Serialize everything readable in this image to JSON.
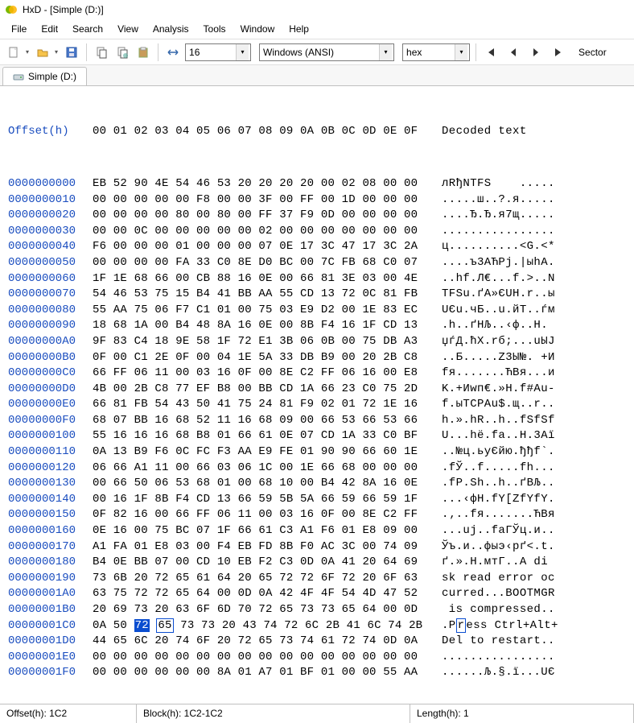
{
  "window_title": "HxD - [Simple (D:)]",
  "menu": {
    "items": [
      "File",
      "Edit",
      "Search",
      "View",
      "Analysis",
      "Tools",
      "Window",
      "Help"
    ]
  },
  "toolbar": {
    "bytes_per_row": "16",
    "encoding": "Windows (ANSI)",
    "numbase": "hex",
    "nav_label": "Sector"
  },
  "tab": {
    "label": "Simple (D:)"
  },
  "hex": {
    "header_offset": "Offset(h)",
    "header_cols": "00 01 02 03 04 05 06 07 08 09 0A 0B 0C 0D 0E 0F",
    "header_decoded": "Decoded text",
    "rows": [
      {
        "o": "0000000000",
        "b": "EB 52 90 4E 54 46 53 20 20 20 20 00 02 08 00 00",
        "d": "лRђNTFS    ....."
      },
      {
        "o": "0000000010",
        "b": "00 00 00 00 00 F8 00 00 3F 00 FF 00 1D 00 00 00",
        "d": ".....ш..?.я....."
      },
      {
        "o": "0000000020",
        "b": "00 00 00 00 80 00 80 00 FF 37 F9 0D 00 00 00 00",
        "d": "....Ђ.Ђ.я7щ....."
      },
      {
        "o": "0000000030",
        "b": "00 00 0C 00 00 00 00 00 02 00 00 00 00 00 00 00",
        "d": "................"
      },
      {
        "o": "0000000040",
        "b": "F6 00 00 00 01 00 00 00 07 0E 17 3C 47 17 3C 2A",
        "d": "ц..........<G.<*"
      },
      {
        "o": "0000000050",
        "b": "00 00 00 00 FA 33 C0 8E D0 BC 00 7C FB 68 C0 07",
        "d": "....ъ3АЋРј.|ыhА."
      },
      {
        "o": "0000000060",
        "b": "1F 1E 68 66 00 CB 88 16 0E 00 66 81 3E 03 00 4E",
        "d": "..hf.Л€...f.>..N"
      },
      {
        "o": "0000000070",
        "b": "54 46 53 75 15 B4 41 BB AA 55 CD 13 72 0C 81 FB",
        "d": "TFSu.ґA»ЄUН.r..ы"
      },
      {
        "o": "0000000080",
        "b": "55 AA 75 06 F7 C1 01 00 75 03 E9 D2 00 1E 83 EC",
        "d": "UЄu.чБ..u.йТ..ѓм"
      },
      {
        "o": "0000000090",
        "b": "18 68 1A 00 B4 48 8A 16 0E 00 8B F4 16 1F CD 13",
        "d": ".h..ґHЉ..‹ф..Н."
      },
      {
        "o": "00000000A0",
        "b": "9F 83 C4 18 9E 58 1F 72 E1 3B 06 0B 00 75 DB A3",
        "d": "џѓД.ћX.rб;...uЫЈ"
      },
      {
        "o": "00000000B0",
        "b": "0F 00 C1 2E 0F 00 04 1E 5A 33 DB B9 00 20 2B C8",
        "d": "..Б.....Z3Ы№. +И"
      },
      {
        "o": "00000000C0",
        "b": "66 FF 06 11 00 03 16 0F 00 8E C2 FF 06 16 00 E8",
        "d": "fя.......ЋВя...и"
      },
      {
        "o": "00000000D0",
        "b": "4B 00 2B C8 77 EF B8 00 BB CD 1A 66 23 C0 75 2D",
        "d": "K.+Иwп€.»Н.f#Аu-"
      },
      {
        "o": "00000000E0",
        "b": "66 81 FB 54 43 50 41 75 24 81 F9 02 01 72 1E 16",
        "d": "f.ыTCPAu$.щ..r.."
      },
      {
        "o": "00000000F0",
        "b": "68 07 BB 16 68 52 11 16 68 09 00 66 53 66 53 66",
        "d": "h.».hR..h..fSfSf"
      },
      {
        "o": "0000000100",
        "b": "55 16 16 16 68 B8 01 66 61 0E 07 CD 1A 33 C0 BF",
        "d": "U...hё.fa..Н.3Аї"
      },
      {
        "o": "0000000110",
        "b": "0A 13 B9 F6 0C FC F3 AA E9 FE 01 90 90 66 60 1E",
        "d": "..№ц.ьуЄйю.ђђf`."
      },
      {
        "o": "0000000120",
        "b": "06 66 A1 11 00 66 03 06 1C 00 1E 66 68 00 00 00",
        "d": ".fЎ..f.....fh..."
      },
      {
        "o": "0000000130",
        "b": "00 66 50 06 53 68 01 00 68 10 00 B4 42 8A 16 0E",
        "d": ".fP.Sh..h..ґBЉ.."
      },
      {
        "o": "0000000140",
        "b": "00 16 1F 8B F4 CD 13 66 59 5B 5A 66 59 66 59 1F",
        "d": "...‹фН.fY[ZfYfY."
      },
      {
        "o": "0000000150",
        "b": "0F 82 16 00 66 FF 06 11 00 03 16 0F 00 8E C2 FF",
        "d": ".‚..fя.......ЋВя"
      },
      {
        "o": "0000000160",
        "b": "0E 16 00 75 BC 07 1F 66 61 C3 A1 F6 01 E8 09 00",
        "d": "...uј..faГЎц.и.."
      },
      {
        "o": "0000000170",
        "b": "A1 FA 01 E8 03 00 F4 EB FD 8B F0 AC 3C 00 74 09",
        "d": "Ўъ.и..фыэ‹рґ<.t."
      },
      {
        "o": "0000000180",
        "b": "B4 0E BB 07 00 CD 10 EB F2 C3 0D 0A 41 20 64 69",
        "d": "ґ.».Н.мтГ..A di"
      },
      {
        "o": "0000000190",
        "b": "73 6B 20 72 65 61 64 20 65 72 72 6F 72 20 6F 63",
        "d": "sk read error oc"
      },
      {
        "o": "00000001A0",
        "b": "63 75 72 72 65 64 00 0D 0A 42 4F 4F 54 4D 47 52",
        "d": "curred...BOOTMGR"
      },
      {
        "o": "00000001B0",
        "b": "20 69 73 20 63 6F 6D 70 72 65 73 73 65 64 00 0D",
        "d": " is compressed.."
      },
      {
        "o": "00000001C0",
        "b": "0A 50 72 65 73 73 20 43 74 72 6C 2B 41 6C 74 2B",
        "d": ".Press Ctrl+Alt+",
        "sel_index": 2,
        "caret_index": 3,
        "d_caret_index": 2
      },
      {
        "o": "00000001D0",
        "b": "44 65 6C 20 74 6F 20 72 65 73 74 61 72 74 0D 0A",
        "d": "Del to restart.."
      },
      {
        "o": "00000001E0",
        "b": "00 00 00 00 00 00 00 00 00 00 00 00 00 00 00 00",
        "d": "................"
      },
      {
        "o": "00000001F0",
        "b": "00 00 00 00 00 00 8A 01 A7 01 BF 01 00 00 55 AA",
        "d": "......Љ.§.ї...UЄ"
      }
    ]
  },
  "statusbar": {
    "offset": "Offset(h): 1C2",
    "block": "Block(h): 1C2-1C2",
    "length": "Length(h): 1"
  },
  "icons": {
    "app": "hxd-icon",
    "new": "new-file-icon",
    "open": "open-file-icon",
    "save": "save-icon",
    "cut": "cut-icon",
    "copy": "copy-icon",
    "paste": "paste-icon",
    "fit": "fit-icon",
    "refresh": "refresh-icon",
    "first": "first-icon",
    "prev": "prev-icon",
    "next": "next-icon",
    "last": "last-icon",
    "drive": "drive-icon"
  }
}
